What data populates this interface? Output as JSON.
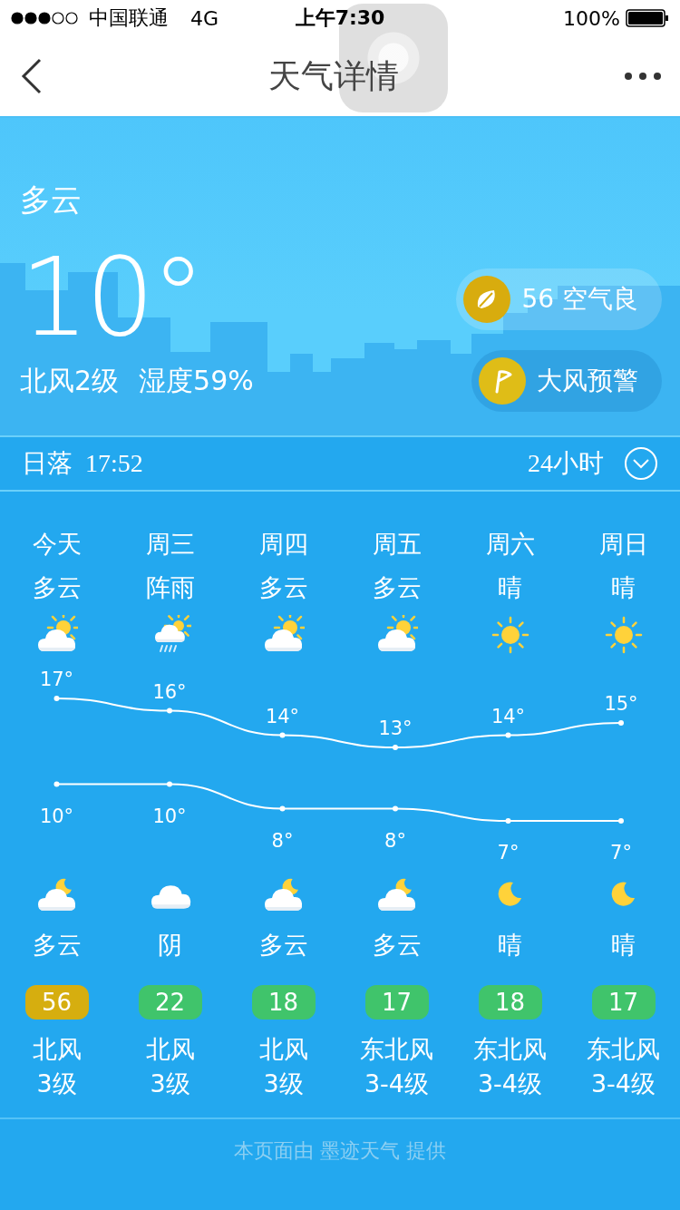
{
  "status_bar": {
    "carrier": "中国联通",
    "network": "4G",
    "time": "上午7:30",
    "battery": "100%"
  },
  "nav": {
    "title": "天气详情"
  },
  "current": {
    "condition": "多云",
    "temperature": "10°",
    "wind": "北风2级",
    "humidity": "湿度59%"
  },
  "badges": [
    {
      "kind": "air",
      "text": "56 空气良"
    },
    {
      "kind": "warning",
      "text": "大风预警"
    }
  ],
  "sun": {
    "label": "日落",
    "time": "17:52",
    "toggle": "24小时"
  },
  "days": [
    {
      "name": "今天",
      "day_weather": "多云",
      "day_icon": {
        "kind": "partly-cloudy"
      },
      "night_weather": "多云",
      "night_icon": {
        "kind": "cloudy-night"
      },
      "aqi": "56",
      "color": "#d6ae0f",
      "wind": "北风",
      "level": "3级"
    },
    {
      "name": "周三",
      "day_weather": "阵雨",
      "day_icon": {
        "kind": "shower"
      },
      "night_weather": "阴",
      "night_icon": {
        "kind": "overcast"
      },
      "aqi": "22",
      "color": "#40c46b",
      "wind": "北风",
      "level": "3级"
    },
    {
      "name": "周四",
      "day_weather": "多云",
      "day_icon": {
        "kind": "partly-cloudy"
      },
      "night_weather": "多云",
      "night_icon": {
        "kind": "cloudy-night"
      },
      "aqi": "18",
      "color": "#40c46b",
      "wind": "北风",
      "level": "3级"
    },
    {
      "name": "周五",
      "day_weather": "多云",
      "day_icon": {
        "kind": "partly-cloudy"
      },
      "night_weather": "多云",
      "night_icon": {
        "kind": "cloudy-night"
      },
      "aqi": "17",
      "color": "#40c46b",
      "wind": "东北风",
      "level": "3-4级"
    },
    {
      "name": "周六",
      "day_weather": "晴",
      "day_icon": {
        "kind": "sunny"
      },
      "night_weather": "晴",
      "night_icon": {
        "kind": "clear-night"
      },
      "aqi": "18",
      "color": "#40c46b",
      "wind": "东北风",
      "level": "3-4级"
    },
    {
      "name": "周日",
      "day_weather": "晴",
      "day_icon": {
        "kind": "sunny"
      },
      "night_weather": "晴",
      "night_icon": {
        "kind": "clear-night"
      },
      "aqi": "17",
      "color": "#40c46b",
      "wind": "东北风",
      "level": "3-4级"
    }
  ],
  "chart_data": {
    "type": "line",
    "data_labels": true,
    "series": [
      {
        "color": "#ffffff",
        "marker": "circle",
        "values": [
          17,
          16,
          14,
          13,
          14,
          15
        ],
        "value_labels": [
          "17°",
          "16°",
          "14°",
          "13°",
          "14°",
          "15°"
        ]
      },
      {
        "color": "#ffffff",
        "marker": "circle",
        "values": [
          10,
          10,
          8,
          8,
          7,
          7
        ],
        "value_labels": [
          "10°",
          "10°",
          "8°",
          "8°",
          "7°",
          "7°"
        ]
      }
    ]
  },
  "footer": "本页面由 墨迹天气 提供"
}
